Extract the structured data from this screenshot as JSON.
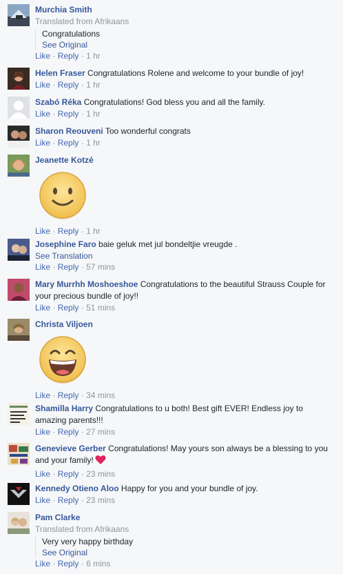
{
  "actions": {
    "like": "Like",
    "reply": "Reply",
    "separator": "·"
  },
  "comments": [
    {
      "name": "Murchia Smith",
      "translated": "Translated from Afrikaans",
      "quote": "Congratulations",
      "see_original": "See Original",
      "time": "1 hr"
    },
    {
      "name": "Helen Fraser",
      "text": "Congratulations Rolene and welcome to your bundle of joy!",
      "time": "1 hr"
    },
    {
      "name": "Szabó Réka",
      "text": "Congratulations! God bless you and all the family.",
      "time": "1 hr"
    },
    {
      "name": "Sharon Reouveni",
      "text": "Too wonderful congrats",
      "time": "1 hr"
    },
    {
      "name": "Jeanette Kotzé",
      "sticker": "smiling-face-icon",
      "time": "1 hr"
    },
    {
      "name": "Josephine Faro",
      "text": "baie geluk met jul bondeltjie vreugde .",
      "see_translation": "See Translation",
      "time": "57 mins"
    },
    {
      "name": "Mary Murrhh Moshoeshoe",
      "text": "Congratulations to the beautiful Strauss Couple for your precious bundle of joy!!",
      "time": "51 mins"
    },
    {
      "name": "Christa Viljoen",
      "sticker": "laughing-face-icon",
      "time": "34 mins"
    },
    {
      "name": "Shamilla Harry",
      "text": "Congratulations to u both! Best gift EVER! Endless joy to amazing parents!!!",
      "time": "27 mins"
    },
    {
      "name": "Genevieve Gerber",
      "text": "Congratulations! May yours son always be a blessing to you and your family!",
      "emoji": "heart-icon",
      "time": "23 mins"
    },
    {
      "name": "Kennedy Otieno Aloo",
      "text": "Happy for you and your bundle of joy.",
      "time": "23 mins"
    },
    {
      "name": "Pam Clarke",
      "translated": "Translated from Afrikaans",
      "quote": "Very very happy birthday",
      "see_original": "See Original",
      "time": "6 mins"
    }
  ],
  "colors": {
    "name": "#365899",
    "link": "#4267b2",
    "meta": "#90949c",
    "text": "#1d2129",
    "background": "#f6f7f9",
    "heart": "#e0245e"
  }
}
